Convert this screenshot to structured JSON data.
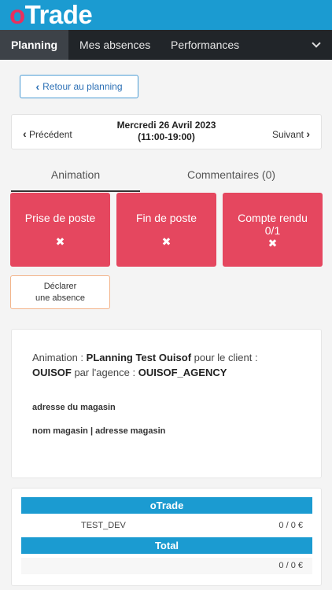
{
  "app": {
    "logo_o": "o",
    "logo_rest": "Trade"
  },
  "nav": {
    "items": [
      {
        "label": "Planning",
        "active": true
      },
      {
        "label": "Mes absences",
        "active": false
      },
      {
        "label": "Performances",
        "active": false
      }
    ]
  },
  "back": {
    "label": "Retour au planning"
  },
  "date_nav": {
    "prev_label": "Précédent",
    "next_label": "Suivant",
    "date": "Mercredi 26 Avril 2023",
    "time": "(11:00-19:00)"
  },
  "tabs": [
    {
      "label": "Animation",
      "active": true
    },
    {
      "label": "Commentaires (0)",
      "active": false
    }
  ],
  "actions": [
    {
      "label": "Prise de poste",
      "sub": "",
      "icon": "✖"
    },
    {
      "label": "Fin de poste",
      "sub": "",
      "icon": "✖"
    },
    {
      "label": "Compte rendu",
      "sub": "0/1",
      "icon": "✖"
    }
  ],
  "absence": {
    "line1": "Déclarer",
    "line2": "une absence"
  },
  "info": {
    "animation_label": "Animation : ",
    "animation_name": "PLanning Test Ouisof",
    "client_label": " pour le client : ",
    "client_name": "OUISOF",
    "agency_label": " par l'agence : ",
    "agency_name": "OUISOF_AGENCY",
    "address_label": "adresse du magasin",
    "store_line": "nom magasin | adresse magasin"
  },
  "table": {
    "section1_header": "oTrade",
    "rows": [
      {
        "name": "TEST_DEV",
        "value": "0 / 0 €"
      }
    ],
    "total_header": "Total",
    "total_value": "0 / 0 €"
  },
  "colors": {
    "brand_blue": "#1b9bd1",
    "accent_red": "#e5475f",
    "nav_dark": "#212529",
    "logo_pink": "#e8305e"
  }
}
